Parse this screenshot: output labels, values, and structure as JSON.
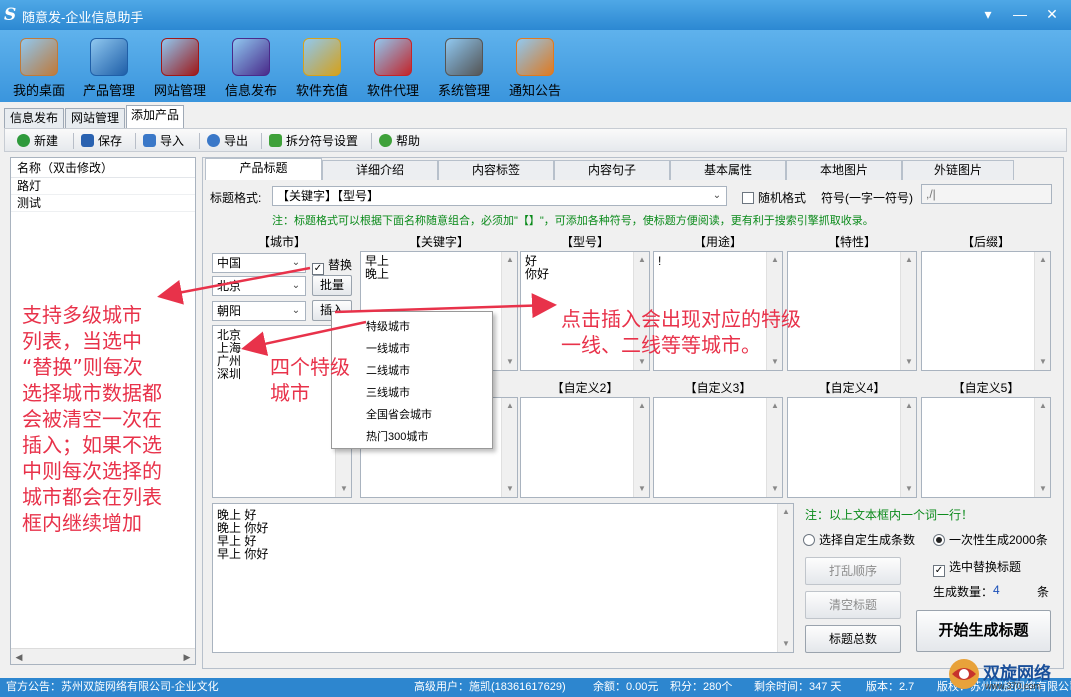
{
  "window": {
    "logo_letter": "S",
    "title": "随意发-企业信息助手",
    "controls": [
      "▾",
      "—",
      "✕"
    ]
  },
  "main_toolbar": [
    {
      "label": "我的桌面",
      "icon": "house-icon",
      "color": "#c07a3a"
    },
    {
      "label": "产品管理",
      "icon": "cloud-drive-icon",
      "color": "#1f5fa8"
    },
    {
      "label": "网站管理",
      "icon": "factory-icon",
      "color": "#a01818"
    },
    {
      "label": "信息发布",
      "icon": "magic-wand-icon",
      "color": "#4a2a8a"
    },
    {
      "label": "软件充值",
      "icon": "coins-chart-icon",
      "color": "#d6a21c"
    },
    {
      "label": "软件代理",
      "icon": "gift-box-icon",
      "color": "#c4252a"
    },
    {
      "label": "系统管理",
      "icon": "gear-icon",
      "color": "#555555"
    },
    {
      "label": "通知公告",
      "icon": "notepad-icon",
      "color": "#e07a20"
    }
  ],
  "doc_tabs": [
    "信息发布",
    "网站管理",
    "添加产品"
  ],
  "action_toolbar": [
    {
      "label": "新建",
      "icon": "add-icon",
      "color": "#2f9a3c"
    },
    {
      "label": "保存",
      "icon": "save-icon",
      "color": "#2a62b0"
    },
    {
      "label": "导入",
      "icon": "folder-open-icon",
      "color": "#3a78c8"
    },
    {
      "label": "导出",
      "icon": "export-icon",
      "color": "#3a78c8"
    },
    {
      "label": "拆分符号设置",
      "icon": "upload-arrow-icon",
      "color": "#3fa13a"
    },
    {
      "label": "帮助",
      "icon": "help-icon",
      "color": "#3fa13a"
    }
  ],
  "left_list": {
    "header": "名称（双击修改）",
    "items": [
      "路灯",
      "测试"
    ]
  },
  "sub_tabs": [
    "产品标题",
    "详细介绍",
    "内容标签",
    "内容句子",
    "基本属性",
    "本地图片",
    "外链图片"
  ],
  "title_format": {
    "label": "标题格式:",
    "value": "【关键字】【型号】",
    "random_label": "随机格式",
    "symbol_label": "符号(一字一符号)",
    "symbol_value": ",/|",
    "note": "注：标题格式可以根据下面名称随意组合，必须加\"【】\"，可添加各种符号，使标题方便阅读，更有利于搜索引擎抓取收录。"
  },
  "city": {
    "header": "【城市】",
    "country": "中国",
    "province": "北京",
    "district": "朝阳",
    "replace_label": "替换",
    "batch_label": "批量",
    "insert_label": "插入",
    "cities": "北京\n上海\n广州\n深圳"
  },
  "columns": [
    {
      "header": "【关键字】",
      "text": "早上\n晚上"
    },
    {
      "header": "【型号】",
      "text": "好\n你好"
    },
    {
      "header": "【用途】",
      "text": "!"
    },
    {
      "header": "【特性】",
      "text": ""
    },
    {
      "header": "【后缀】",
      "text": ""
    }
  ],
  "custom_columns": [
    "【自定义2】",
    "【自定义3】",
    "【自定义4】",
    "【自定义5】"
  ],
  "popup_menu": [
    "特级城市",
    "一线城市",
    "二线城市",
    "三线城市",
    "全国省会城市",
    "热门300城市"
  ],
  "output_text": "晚上 好\n晚上 你好\n早上 好\n早上 你好",
  "right_options": {
    "note": "注：以上文本框内一个词一行！",
    "radio_custom": "选择自定生成条数",
    "radio_once": "一次性生成2000条",
    "check_replace": "选中替换标题",
    "count_label": "生成数量：",
    "count_value": "4",
    "count_unit": "条",
    "shuffle_label": "打乱顺序",
    "clear_label": "清空标题",
    "total_label": "标题总数",
    "start_label": "开始生成标题"
  },
  "annotations": {
    "city_support": "支持多级城市\n列表，当选中\n“替换”则每次\n选择城市数据都\n会被清空一次在\n插入；如果不选\n中则每次选择的\n城市都会在列表\n框内继续增加",
    "four_cities": "四个特级\n城市",
    "insert_hint": "点击插入会出现对应的特级\n一线、二线等等城市。"
  },
  "status": {
    "notice": "官方公告：苏州双旋网络有限公司-企业文化",
    "user": "高级用户：施凯(18361617629)",
    "balance": "余额：0.00元",
    "points": "积分：280个",
    "remaining": "剩余时间：347 天",
    "version": "版本：2.7",
    "copyright": "版权：苏州双旋网络有限公司"
  },
  "watermark": {
    "brand": "双旋网络",
    "url": "www.370.com"
  }
}
